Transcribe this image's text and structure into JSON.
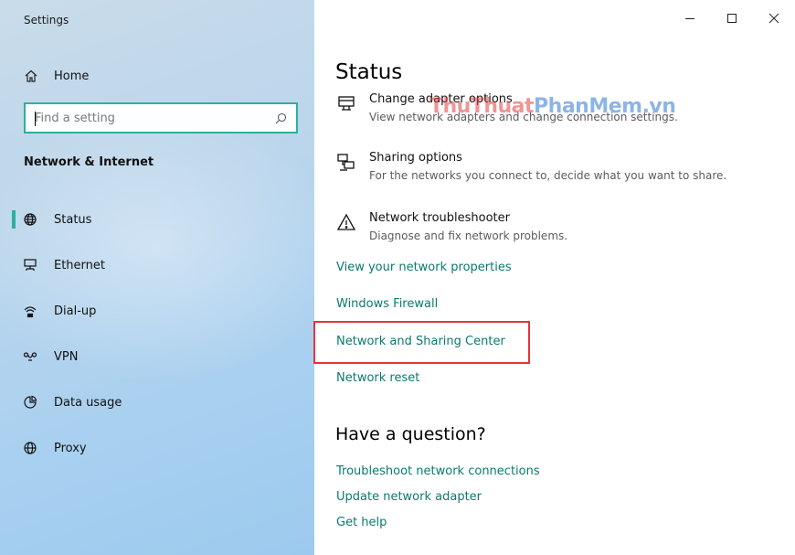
{
  "window": {
    "title": "Settings"
  },
  "sidebar": {
    "home_label": "Home",
    "search_placeholder": "Find a setting",
    "section_title": "Network & Internet",
    "items": [
      {
        "label": "Status",
        "icon": "globe-icon",
        "selected": true
      },
      {
        "label": "Ethernet",
        "icon": "ethernet-icon",
        "selected": false
      },
      {
        "label": "Dial-up",
        "icon": "dial-up-icon",
        "selected": false
      },
      {
        "label": "VPN",
        "icon": "vpn-icon",
        "selected": false
      },
      {
        "label": "Data usage",
        "icon": "data-usage-icon",
        "selected": false
      },
      {
        "label": "Proxy",
        "icon": "globe-icon",
        "selected": false
      }
    ]
  },
  "main": {
    "title": "Status",
    "options": [
      {
        "title": "Change adapter options",
        "desc": "View network adapters and change connection settings.",
        "icon": "adapter-icon"
      },
      {
        "title": "Sharing options",
        "desc": "For the networks you connect to, decide what you want to share.",
        "icon": "sharing-icon"
      },
      {
        "title": "Network troubleshooter",
        "desc": "Diagnose and fix network problems.",
        "icon": "warning-icon"
      }
    ],
    "links": [
      "View your network properties",
      "Windows Firewall",
      "Network and Sharing Center",
      "Network reset"
    ],
    "question_title": "Have a question?",
    "help_links": [
      "Troubleshoot network connections",
      "Update network adapter",
      "Get help"
    ]
  },
  "watermark": {
    "part1": "ThuThuat",
    "part2": "PhanMem.vn"
  },
  "colors": {
    "accent": "#2bb0a0",
    "link": "#0a7a6e",
    "highlight": "#e8333b"
  }
}
